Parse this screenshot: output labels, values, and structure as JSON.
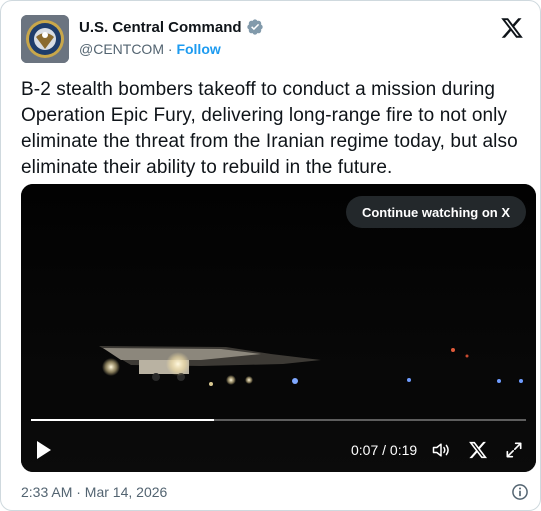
{
  "author": {
    "name": "U.S. Central Command",
    "handle": "@CENTCOM",
    "separator": "·",
    "follow_label": "Follow",
    "verified": true
  },
  "tweet": {
    "text": "B-2 stealth bombers takeoff to conduct a mission during Operation Epic Fury, delivering long-range fire to not only eliminate the threat from the Iranian regime today, but also eliminate their ability to rebuild in the future."
  },
  "video": {
    "continue_label": "Continue watching on X",
    "time_display": "0:07 / 0:19",
    "progress_fraction": 0.37
  },
  "footer": {
    "timestamp": "2:33 AM · Mar 14, 2026"
  },
  "icons": {
    "verified": "verified-badge-icon",
    "brand": "x-logo-icon",
    "play": "play-icon",
    "volume": "volume-icon",
    "expand": "fullscreen-icon",
    "info": "info-icon"
  },
  "colors": {
    "link": "#1d9bf0",
    "secondary_text": "#536471",
    "primary_text": "#0f1419",
    "verified_badge": "#829aab"
  }
}
